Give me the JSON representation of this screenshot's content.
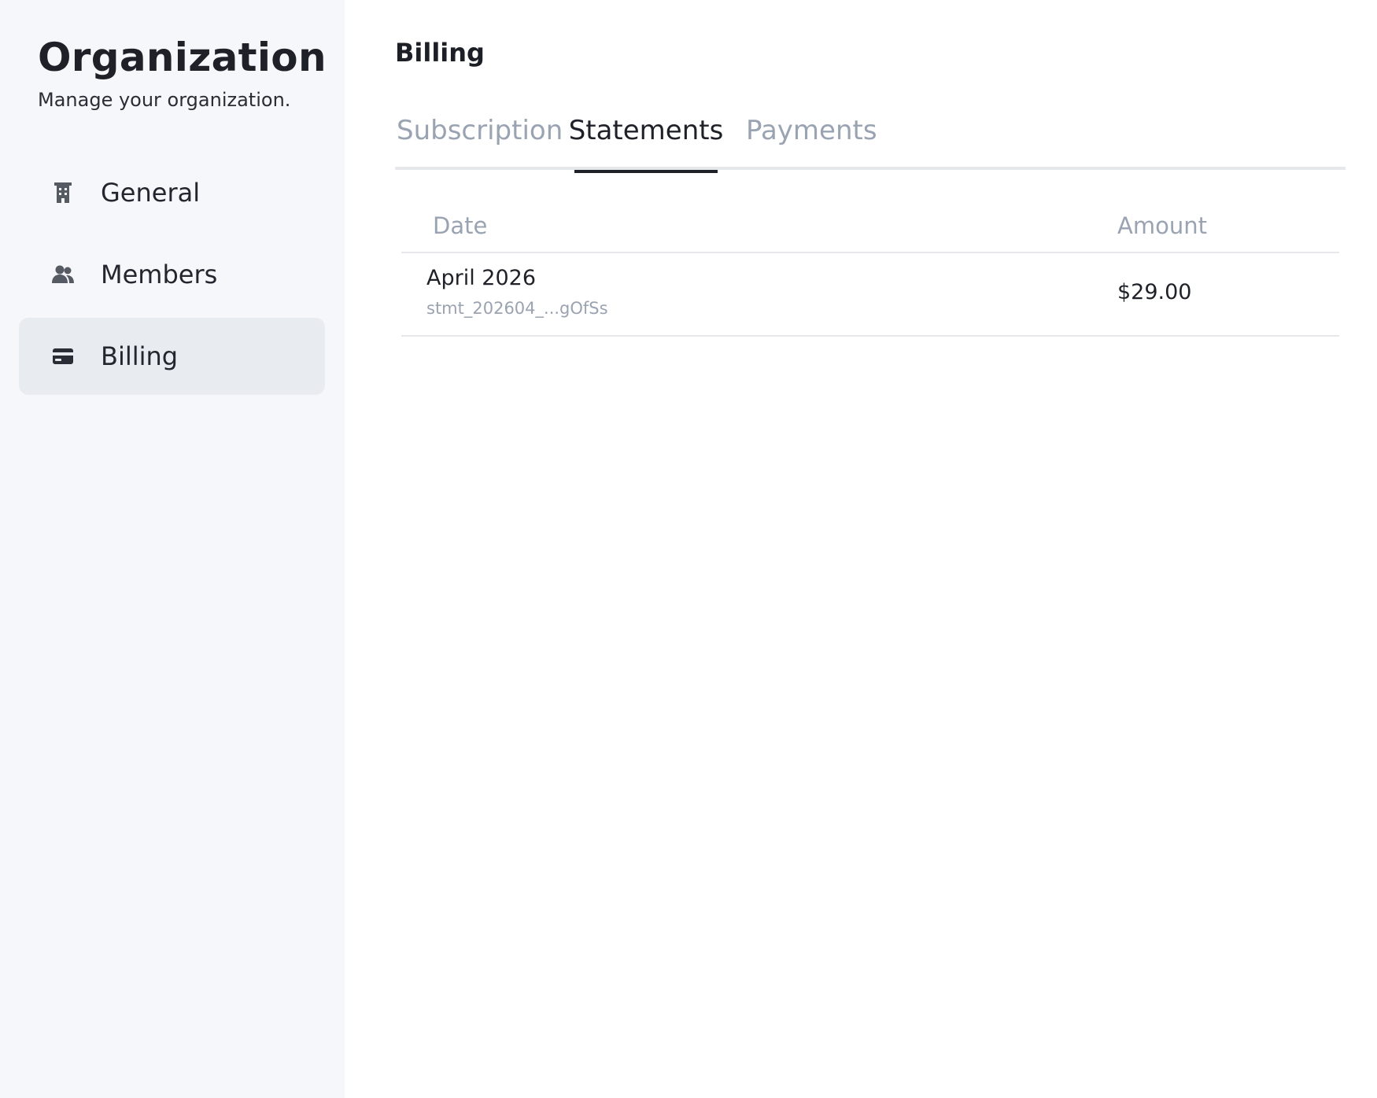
{
  "sidebar": {
    "title": "Organization",
    "subtitle": "Manage your organization.",
    "items": [
      {
        "label": "General",
        "icon": "building-icon",
        "active": false
      },
      {
        "label": "Members",
        "icon": "users-icon",
        "active": false
      },
      {
        "label": "Billing",
        "icon": "credit-card-icon",
        "active": true
      }
    ]
  },
  "main": {
    "title": "Billing",
    "tabs": [
      {
        "label": "Subscription",
        "active": false
      },
      {
        "label": "Statements",
        "active": true
      },
      {
        "label": "Payments",
        "active": false
      }
    ],
    "table": {
      "headers": {
        "date": "Date",
        "amount": "Amount"
      },
      "rows": [
        {
          "date": "April 2026",
          "id": "stmt_202604_...gOfSs",
          "amount": "$29.00"
        }
      ]
    }
  },
  "colors": {
    "sidebar_bg": "#f5f7fb",
    "active_nav_bg": "#e8ebf0",
    "muted_text": "#9aa3b2",
    "primary_text": "#1f2128",
    "divider": "#e6e8ec"
  }
}
